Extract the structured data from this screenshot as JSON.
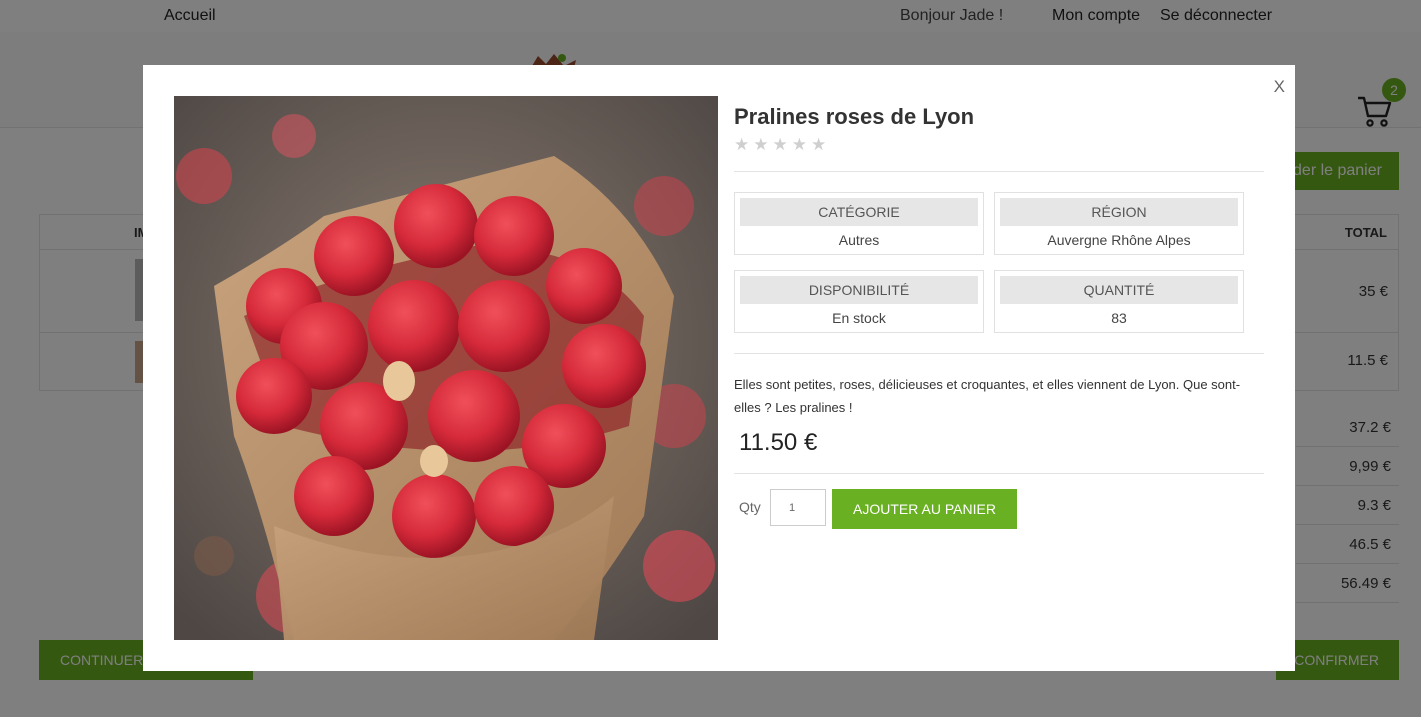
{
  "topbar": {
    "home": "Accueil",
    "greeting": "Bonjour Jade !",
    "account": "Mon compte",
    "logout": "Se déconnecter"
  },
  "header": {
    "cart_count": "2"
  },
  "page": {
    "validate_label": "der le panier",
    "continue_label": "CONTINUER",
    "confirm_label": "CONFIRMER",
    "table": {
      "col_image": "IM",
      "col_total": "TOTAL",
      "row_totals": [
        "35 €",
        "11.5 €"
      ]
    },
    "summary": [
      "37.2 €",
      "9,99 €",
      "9.3 €",
      "46.5 €",
      "56.49 €"
    ]
  },
  "modal": {
    "close": "X",
    "title": "Pralines roses de Lyon",
    "rating": 0,
    "info": {
      "category_label": "Catégorie",
      "category_value": "Autres",
      "region_label": "Région",
      "region_value": "Auvergne Rhône Alpes",
      "availability_label": "Disponibilité",
      "availability_value": "En stock",
      "quantity_label": "Quantité",
      "quantity_value": "83"
    },
    "description": "Elles sont petites, roses, délicieuses et croquantes, et elles viennent de Lyon. Que sont-elles ? Les pralines !",
    "price": "11.50 €",
    "qty_label": "Qty",
    "qty_value": "1",
    "add_to_cart": "Ajouter au panier"
  },
  "colors": {
    "accent": "#6ab023",
    "overlay": "rgba(0,0,0,0.5)"
  }
}
